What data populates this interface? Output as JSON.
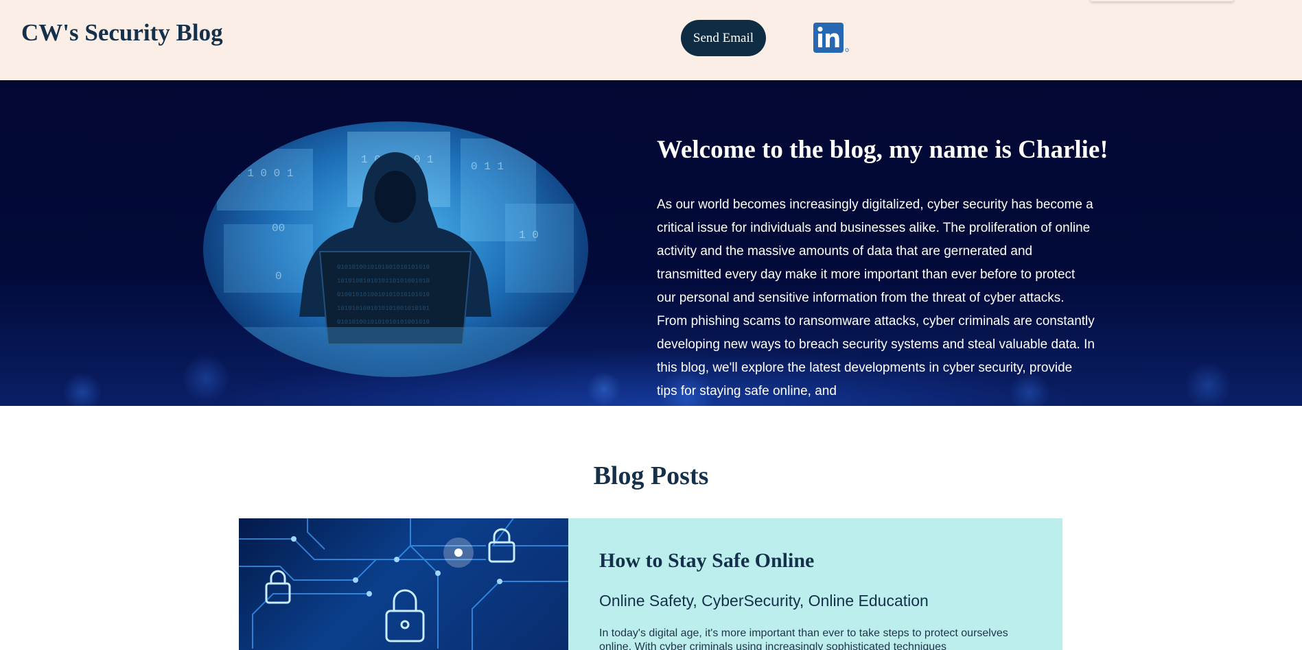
{
  "header": {
    "site_title": "CW's Security Blog",
    "send_email_label": "Send Email",
    "linkedin_icon": "linkedin-icon",
    "background": "#fbeee6",
    "text_color": "#14304a",
    "button_color": "#0e2c44"
  },
  "hero": {
    "image_icon": "hooded-hacker-laptop-image",
    "heading": "Welcome to the blog, my name is Charlie!",
    "intro": "As our world becomes increasingly digitalized, cyber security has become a critical issue for individuals and businesses alike. The proliferation of online activity and the massive amounts of data that are gernerated and transmitted every day make it more important than ever before to protect our personal and sensitive information from the threat of cyber attacks. From phishing scams to ransomware attacks, cyber criminals are constantly developing new ways to breach security systems and steal valuable data. In this blog, we'll explore the latest developments in cyber security, provide tips for staying safe online, and",
    "background": "#030833"
  },
  "blog": {
    "section_title": "Blog Posts",
    "posts": [
      {
        "image_icon": "circuit-board-padlock-image",
        "title": "How to Stay Safe Online",
        "tags": "Online Safety, CyberSecurity, Online Education",
        "excerpt": "In today's digital age, it's more important than ever to take steps to protect ourselves online. With cyber criminals using increasingly sophisticated techniques",
        "card_color": "#bdeeee"
      }
    ]
  }
}
